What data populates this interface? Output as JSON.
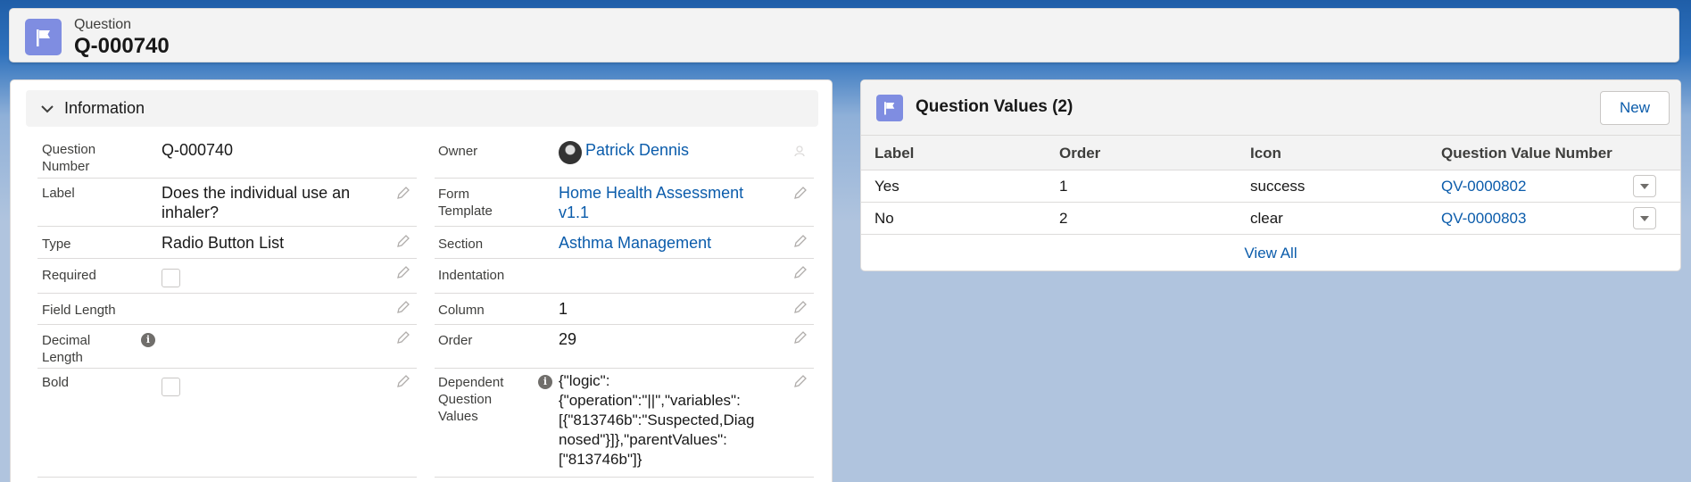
{
  "header": {
    "object_type": "Question",
    "record_name": "Q-000740",
    "icon": "flag-icon",
    "icon_color": "#7f8de1"
  },
  "info_section": {
    "title": "Information",
    "left_fields": {
      "question_number": {
        "label": "Question\nNumber",
        "value": "Q-000740"
      },
      "label": {
        "label": "Label",
        "value": "Does the individual use an\ninhaler?"
      },
      "type": {
        "label": "Type",
        "value": "Radio Button List"
      },
      "required": {
        "label": "Required",
        "checked": false
      },
      "field_length": {
        "label": "Field Length",
        "value": ""
      },
      "decimal_length": {
        "label": "Decimal\nLength",
        "value": ""
      },
      "bold": {
        "label": "Bold",
        "checked": false
      }
    },
    "right_fields": {
      "owner": {
        "label": "Owner",
        "value": "Patrick Dennis"
      },
      "form_template": {
        "label": "Form\nTemplate",
        "value": "Home Health Assessment\nv1.1"
      },
      "section": {
        "label": "Section",
        "value": "Asthma Management"
      },
      "indentation": {
        "label": "Indentation",
        "value": ""
      },
      "column": {
        "label": "Column",
        "value": "1"
      },
      "order": {
        "label": "Order",
        "value": "29"
      },
      "dependent_question_values": {
        "label": "Dependent\nQuestion\nValues",
        "value": "{\"logic\":\n{\"operation\":\"||\",\"variables\":\n[{\"813746b\":\"Suspected,Diag\nnosed\"}]},\"parentValues\":\n[\"813746b\"]}"
      }
    }
  },
  "related_list": {
    "title": "Question Values (2)",
    "new_label": "New",
    "columns": [
      "Label",
      "Order",
      "Icon",
      "Question Value Number"
    ],
    "rows": [
      {
        "label": "Yes",
        "order": "1",
        "icon": "success",
        "number": "QV-0000802"
      },
      {
        "label": "No",
        "order": "2",
        "icon": "clear",
        "number": "QV-0000803"
      }
    ],
    "view_all": "View All"
  },
  "colors": {
    "link": "#0b5cab",
    "brand_icon": "#7f8de1"
  }
}
